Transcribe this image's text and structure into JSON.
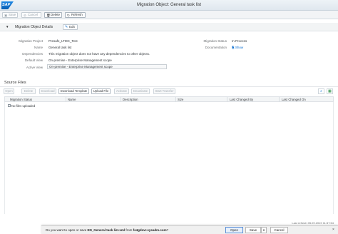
{
  "shell": {
    "logo": "SAP",
    "title": "Migration Object: General task list"
  },
  "toolbar": {
    "save": "Save",
    "cancel": "Cancel",
    "delete": "Delete",
    "refresh": "Refresh",
    "save_icon": "save-icon",
    "cancel_icon": "cancel-icon",
    "delete_icon": "trash-icon",
    "refresh_icon": "refresh-icon"
  },
  "details": {
    "title": "Migration Object Details",
    "edit": "Edit",
    "fields": {
      "migration_project_label": "Migration Project",
      "migration_project": "Presafe_LTMC_Test",
      "name_label": "Name",
      "name": "General task list",
      "dependencies_label": "Dependencies",
      "dependencies": "This migration object does not have any dependencies to other objects.",
      "default_view_label": "Default View",
      "default_view": "On-premise - Enterprise Management scope",
      "active_view_label": "Active View",
      "active_view": "On-premise - Enterprise Management scope",
      "migration_status_label": "Migration Status",
      "migration_status": "In Process",
      "documentation_label": "Documentation",
      "documentation": "Show"
    }
  },
  "source_files": {
    "title": "Source Files",
    "buttons": {
      "open": "Open",
      "delete": "Delete",
      "download": "Download",
      "download_template": "Download Template",
      "upload_file": "Upload File",
      "activate": "Activate",
      "deactivate": "Deactivate",
      "start_transfer": "Start Transfer"
    },
    "columns": [
      "Migration Status",
      "Name",
      "Description",
      "Size",
      "Last Changed By",
      "Last Changed On"
    ],
    "empty_text": "No files uploaded"
  },
  "status_bar": {
    "last_refresh": "Last refresh 05.09.2019 11:57:54"
  },
  "download_bar": {
    "prefix": "Do you want to open or save ",
    "file": "EN_General task list.xml",
    "middle": " from ",
    "host": "fs4gdsvr.sysadm.com",
    "suffix": "?",
    "open": "Open",
    "save": "Save",
    "cancel": "Cancel",
    "close": "×"
  },
  "colors": {
    "accent": "#0a6ed1",
    "shell_bg": "#dfe7ee"
  }
}
